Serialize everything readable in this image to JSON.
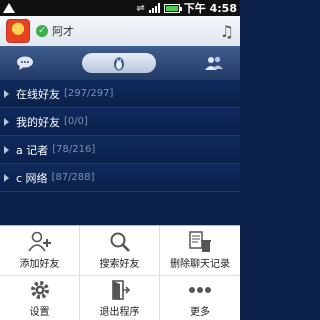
{
  "statusbar": {
    "time": "下午 4:58"
  },
  "header": {
    "nickname": "阿才"
  },
  "groups": [
    {
      "name": "在线好友",
      "count": "[297/297]"
    },
    {
      "name": "我的好友",
      "count": "[0/0]"
    },
    {
      "name": "a 记者",
      "count": "[78/216]"
    },
    {
      "name": "c 网络",
      "count": "[87/288]"
    }
  ],
  "menu": [
    {
      "label": "添加好友",
      "icon": "add-user-icon"
    },
    {
      "label": "搜索好友",
      "icon": "search-icon"
    },
    {
      "label": "删除聊天记录",
      "icon": "delete-record-icon"
    },
    {
      "label": "设置",
      "icon": "settings-icon"
    },
    {
      "label": "退出程序",
      "icon": "exit-icon"
    },
    {
      "label": "更多",
      "icon": "more-icon"
    }
  ],
  "colors": {
    "list_bg": "#0a214c",
    "tabs_bg": "#2c4878",
    "count_text": "#7c8fb3",
    "online": "#3cb04a"
  }
}
